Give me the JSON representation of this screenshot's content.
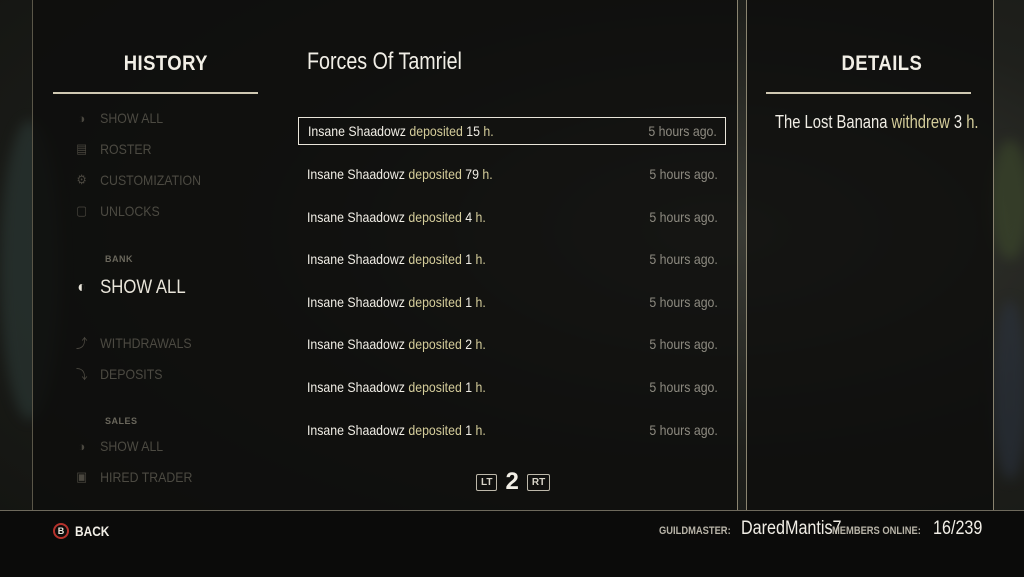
{
  "left_heading": "HISTORY",
  "guild_name": "Forces Of Tamriel",
  "details_heading": "DETAILS",
  "nav": {
    "general_items": [
      {
        "label": "SHOW ALL",
        "icon": "eye-icon"
      },
      {
        "label": "ROSTER",
        "icon": "roster-icon"
      },
      {
        "label": "CUSTOMIZATION",
        "icon": "gears-icon"
      },
      {
        "label": "UNLOCKS",
        "icon": "unlock-icon"
      }
    ],
    "bank_section": "BANK",
    "bank_items": [
      {
        "label": "SHOW ALL",
        "icon": "eye-icon",
        "active": true
      },
      {
        "label": "WITHDRAWALS",
        "icon": "withdraw-icon"
      },
      {
        "label": "DEPOSITS",
        "icon": "deposit-icon"
      }
    ],
    "sales_section": "SALES",
    "sales_items": [
      {
        "label": "SHOW ALL",
        "icon": "eye-icon"
      },
      {
        "label": "HIRED TRADER",
        "icon": "trader-icon"
      }
    ]
  },
  "events": [
    {
      "name": "Insane Shaadowz",
      "action": "deposited",
      "amount": "15",
      "unit": "h.",
      "time": "5 hours ago."
    },
    {
      "name": "Insane Shaadowz",
      "action": "deposited",
      "amount": "79",
      "unit": "h.",
      "time": "5 hours ago."
    },
    {
      "name": "Insane Shaadowz",
      "action": "deposited",
      "amount": "4",
      "unit": "h.",
      "time": "5 hours ago."
    },
    {
      "name": "Insane Shaadowz",
      "action": "deposited",
      "amount": "1",
      "unit": "h.",
      "time": "5 hours ago."
    },
    {
      "name": "Insane Shaadowz",
      "action": "deposited",
      "amount": "1",
      "unit": "h.",
      "time": "5 hours ago."
    },
    {
      "name": "Insane Shaadowz",
      "action": "deposited",
      "amount": "2",
      "unit": "h.",
      "time": "5 hours ago."
    },
    {
      "name": "Insane Shaadowz",
      "action": "deposited",
      "amount": "1",
      "unit": "h.",
      "time": "5 hours ago."
    },
    {
      "name": "Insane Shaadowz",
      "action": "deposited",
      "amount": "1",
      "unit": "h.",
      "time": "5 hours ago."
    }
  ],
  "pager": {
    "prev": "LT",
    "page": "2",
    "next": "RT"
  },
  "details": {
    "name": "The Lost Banana",
    "action": "withdrew",
    "amount": "3",
    "unit": "h."
  },
  "footer": {
    "back_button_glyph": "B",
    "back_label": "BACK",
    "guildmaster_label": "GUILDMASTER:",
    "guildmaster_name": "DaredMantis7",
    "members_label": "MEMBERS ONLINE:",
    "members_value": "16/239"
  },
  "colors": {
    "highlight": "#d4cc9a",
    "back_ring": "#b6322c"
  }
}
